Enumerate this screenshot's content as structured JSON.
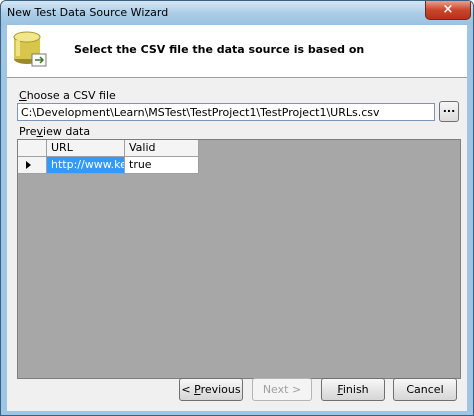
{
  "window": {
    "title": "New Test Data Source Wizard",
    "close_glyph": "×"
  },
  "header": {
    "instruction": "Select the CSV file the data source is based on",
    "icon": "database-icon"
  },
  "csv": {
    "label_prefix": "",
    "label_accel": "C",
    "label_rest": "hoose a CSV file",
    "path": "C:\\Development\\Learn\\MSTest\\TestProject1\\TestProject1\\URLs.csv",
    "browse_label": "..."
  },
  "preview": {
    "label_prefix": "Pre",
    "label_accel": "v",
    "label_rest": "iew data",
    "columns": [
      "URL",
      "Valid"
    ],
    "rows": [
      {
        "url": "http://www.kei...",
        "valid": "true"
      }
    ]
  },
  "buttons": {
    "previous_prefix": "< ",
    "previous_accel": "P",
    "previous_rest": "revious",
    "next": "Next >",
    "finish_accel": "F",
    "finish_rest": "inish",
    "cancel": "Cancel"
  }
}
